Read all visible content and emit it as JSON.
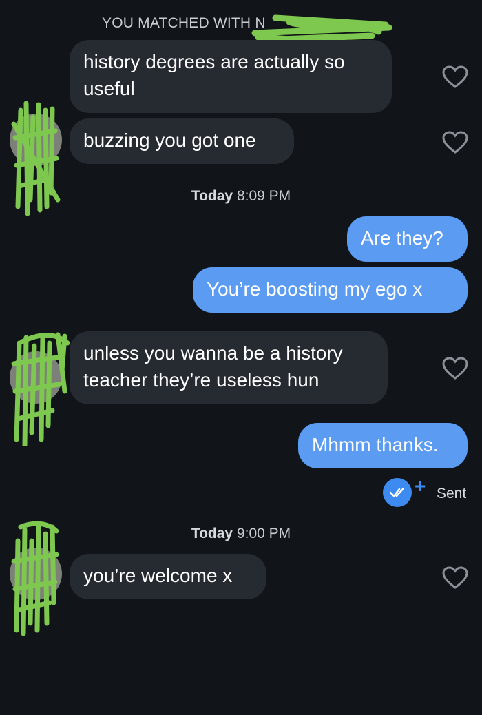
{
  "header": {
    "matched_text": "YOU MATCHED WITH N"
  },
  "messages": [
    {
      "side": "in",
      "text": "history degrees are actually so useful"
    },
    {
      "side": "in",
      "text": "buzzing you got one"
    },
    {
      "side": "out",
      "text": "Are they?"
    },
    {
      "side": "out",
      "text": "You’re boosting my ego x"
    },
    {
      "side": "in",
      "text": "unless you wanna be a history teacher they’re useless hun"
    },
    {
      "side": "out",
      "text": "Mhmm thanks."
    },
    {
      "side": "in",
      "text": "you’re welcome x"
    }
  ],
  "timestamps": [
    {
      "day": "Today",
      "time": "8:09 PM"
    },
    {
      "day": "Today",
      "time": "9:00 PM"
    }
  ],
  "status": {
    "sent_label": "Sent",
    "plus_label": "+"
  },
  "colors": {
    "background": "#111418",
    "incoming_bubble": "#262a31",
    "outgoing_bubble": "#5b9bf2",
    "accent": "#3d8bf0",
    "scribble": "#7ec850"
  },
  "icons": [
    "heart-icon",
    "double-check-icon",
    "plus-icon"
  ]
}
